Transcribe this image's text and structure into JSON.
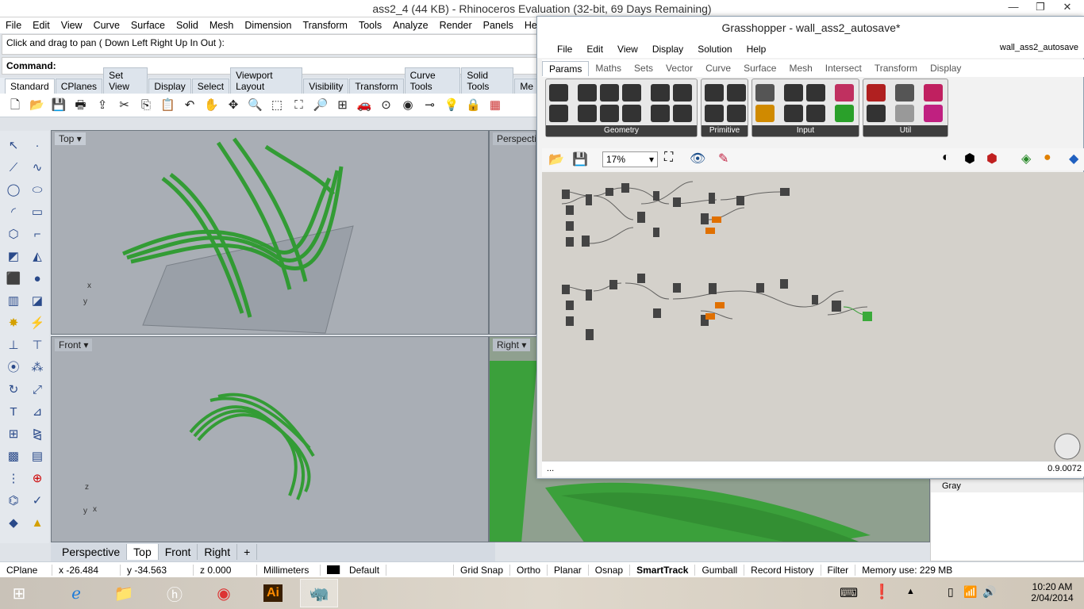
{
  "window": {
    "title": "ass2_4 (44 KB) - Rhinoceros Evaluation (32-bit, 69 Days Remaining)"
  },
  "window_controls": {
    "minimize": "—",
    "restore": "❐",
    "close": "✕"
  },
  "menu": [
    "File",
    "Edit",
    "View",
    "Curve",
    "Surface",
    "Solid",
    "Mesh",
    "Dimension",
    "Transform",
    "Tools",
    "Analyze",
    "Render",
    "Panels",
    "Help"
  ],
  "command": {
    "history": "Click and drag to pan ( Down  Left  Right  Up  In  Out ):",
    "prompt": "Command:"
  },
  "toolbar_tabs": [
    "Standard",
    "CPlanes",
    "Set View",
    "Display",
    "Select",
    "Viewport Layout",
    "Visibility",
    "Transform",
    "Curve Tools",
    "Solid Tools",
    "Me"
  ],
  "viewports": {
    "top": "Top",
    "perspective": "Perspective",
    "front": "Front",
    "right": "Right"
  },
  "axis_labels": {
    "x": "x",
    "y": "y",
    "z": "z"
  },
  "viewport_tabs": [
    "Perspective",
    "Top",
    "Front",
    "Right",
    "+"
  ],
  "status": {
    "cplane": "CPlane",
    "x": "x -26.484",
    "y": "y -34.563",
    "z": "z 0.000",
    "units": "Millimeters",
    "layer": "Default",
    "toggles": [
      "Grid Snap",
      "Ortho",
      "Planar",
      "Osnap",
      "SmartTrack",
      "Gumball",
      "Record History",
      "Filter"
    ],
    "memory": "Memory use: 229 MB"
  },
  "grasshopper": {
    "title": "Grasshopper - wall_ass2_autosave*",
    "file_label": "wall_ass2_autosave",
    "menu": [
      "File",
      "Edit",
      "View",
      "Display",
      "Solution",
      "Help"
    ],
    "tabs": [
      "Params",
      "Maths",
      "Sets",
      "Vector",
      "Curve",
      "Surface",
      "Mesh",
      "Intersect",
      "Transform",
      "Display"
    ],
    "component_groups": [
      "Geometry",
      "Primitive",
      "Input",
      "Util"
    ],
    "zoom": "17%",
    "status_left": "...",
    "version": "0.9.0072"
  },
  "properties": {
    "gray_label": "Gray"
  },
  "taskbar": {
    "time": "10:20 AM",
    "date": "2/04/2014"
  },
  "colors": {
    "accent": "#2e8b2e",
    "geometry": "#1f9a1f"
  }
}
